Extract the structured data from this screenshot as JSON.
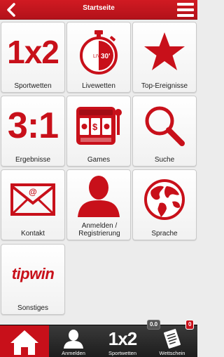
{
  "header": {
    "title": "Startseite",
    "colors": {
      "bar": "#c8101a"
    }
  },
  "tiles": [
    {
      "label": "Sportwetten",
      "icon": "1x2-icon",
      "icon_text": "1x2"
    },
    {
      "label": "Livewetten",
      "icon": "stopwatch-icon",
      "icon_text": "LIVE",
      "icon_text2": "30'"
    },
    {
      "label": "Top-Ereignisse",
      "icon": "star-icon"
    },
    {
      "label": "Ergebnisse",
      "icon": "score-icon",
      "icon_text": "3:1"
    },
    {
      "label": "Games",
      "icon": "slot-machine-icon"
    },
    {
      "label": "Suche",
      "icon": "search-icon"
    },
    {
      "label": "Kontakt",
      "icon": "envelope-icon"
    },
    {
      "label": "Anmelden / Registrierung",
      "icon": "user-icon"
    },
    {
      "label": "Sprache",
      "icon": "globe-icon"
    },
    {
      "label": "Sonstiges",
      "icon": "tipwin-logo",
      "icon_text": "tipwin"
    }
  ],
  "bottom_nav": {
    "home": {
      "label": "",
      "icon": "home-icon"
    },
    "login": {
      "label": "Anmelden",
      "icon": "user-icon"
    },
    "sport": {
      "label": "Sportwetten",
      "icon": "1x2-icon",
      "icon_text": "1x2"
    },
    "slip": {
      "label": "Wettschein",
      "icon": "betslip-icon",
      "amount": "0.0",
      "count": "0"
    }
  },
  "colors": {
    "accent": "#c8101a",
    "nav_bg": "#2a2a2a",
    "tile_bg": "#f7f7f7"
  }
}
